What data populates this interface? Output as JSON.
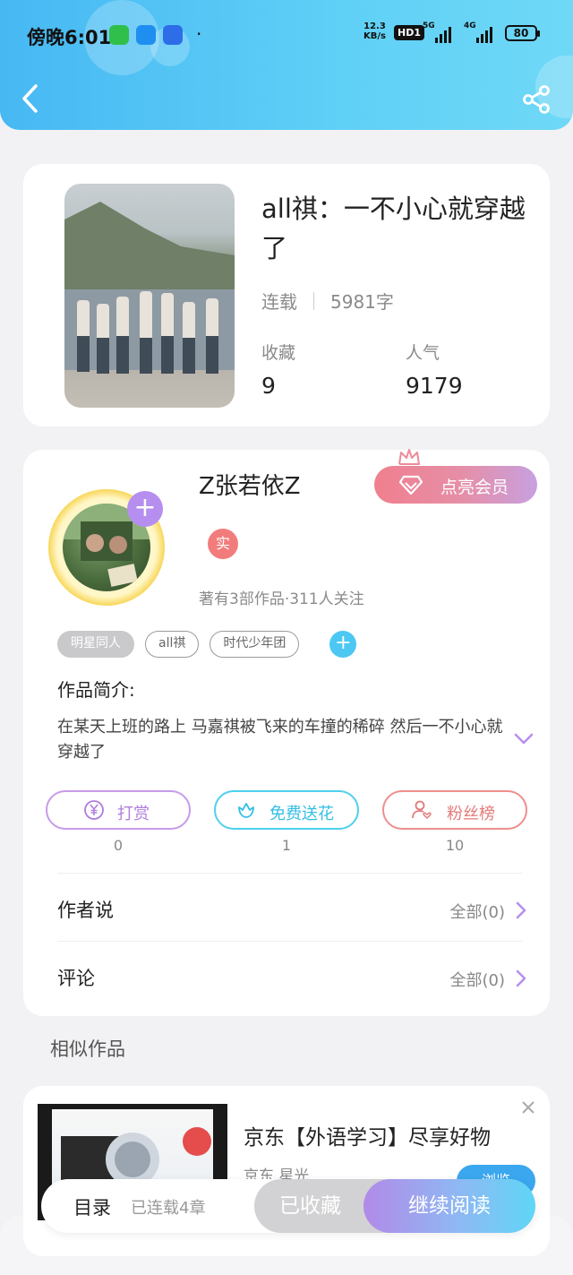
{
  "status_bar": {
    "time": "傍晚6:01",
    "net_speed_value": "12.3",
    "net_speed_unit": "KB/s",
    "hd": "HD1",
    "sig1_label": "5G",
    "sig2_label": "4G",
    "battery": "80"
  },
  "book": {
    "title": "all祺：一不小心就穿越了",
    "status": "连载",
    "word_count": "5981字",
    "collect_label": "收藏",
    "collect_value": "9",
    "popularity_label": "人气",
    "popularity_value": "9179"
  },
  "author": {
    "name": "Z张若依Z",
    "real_badge": "实",
    "meta": "著有3部作品·311人关注",
    "vip_button": "点亮会员"
  },
  "tags": [
    "明星同人",
    "all祺",
    "时代少年团"
  ],
  "intro": {
    "label": "作品简介:",
    "text": "在某天上班的路上 马嘉祺被飞来的车撞的稀碎 然后一不小心就穿越了"
  },
  "actions": {
    "reward_label": "打赏",
    "reward_count": "0",
    "flower_label": "免费送花",
    "flower_count": "1",
    "fans_label": "粉丝榜",
    "fans_count": "10"
  },
  "rows": {
    "author_says": "作者说",
    "author_says_more": "全部(0)",
    "comments": "评论",
    "comments_more": "全部(0)"
  },
  "similar": {
    "title": "相似作品",
    "ad_title": "京东【外语学习】尽享好物",
    "ad_sub": "京东 星光",
    "ad_button": "浏览"
  },
  "bottom_bar": {
    "toc": "目录",
    "chapters": "已连载4章",
    "collected": "已收藏",
    "continue": "继续阅读"
  },
  "colors": {
    "header_blue": "#47b8f3",
    "accent_purple": "#b68ef0",
    "reward_purple": "#c79be9",
    "flower_cyan": "#4fd0ee",
    "fans_red": "#ef8e8e"
  }
}
